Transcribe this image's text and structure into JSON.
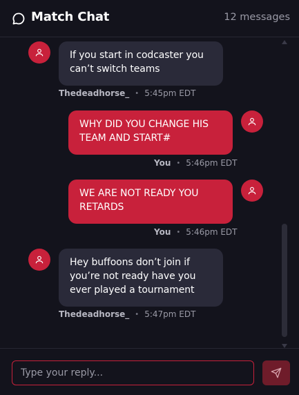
{
  "header": {
    "title": "Match Chat",
    "message_count": "12 messages",
    "icon": "chat-bubble-icon"
  },
  "messages": [
    {
      "from": "other",
      "text": "If you start in codcaster you can’t switch teams",
      "sender": "Thedeadhorse_",
      "time": "5:45pm EDT"
    },
    {
      "from": "me",
      "text": "WHY DID YOU CHANGE HIS TEAM AND START#",
      "sender": "You",
      "time": "5:46pm EDT"
    },
    {
      "from": "me",
      "text": "WE ARE NOT READY YOU RETARDS",
      "sender": "You",
      "time": "5:46pm EDT"
    },
    {
      "from": "other",
      "text": "Hey buffoons don’t join if you’re not ready have you ever played a tournament",
      "sender": "Thedeadhorse_",
      "time": "5:47pm EDT"
    }
  ],
  "composer": {
    "placeholder": "Type your reply...",
    "value": "",
    "send_icon": "send-icon"
  },
  "colors": {
    "background": "#13131c",
    "bubble_other": "#2a2a39",
    "bubble_mine": "#c8213b",
    "accent": "#c8213b",
    "send_button": "#6f1c2a",
    "muted_text": "#9a9aa6"
  },
  "separator": "•"
}
